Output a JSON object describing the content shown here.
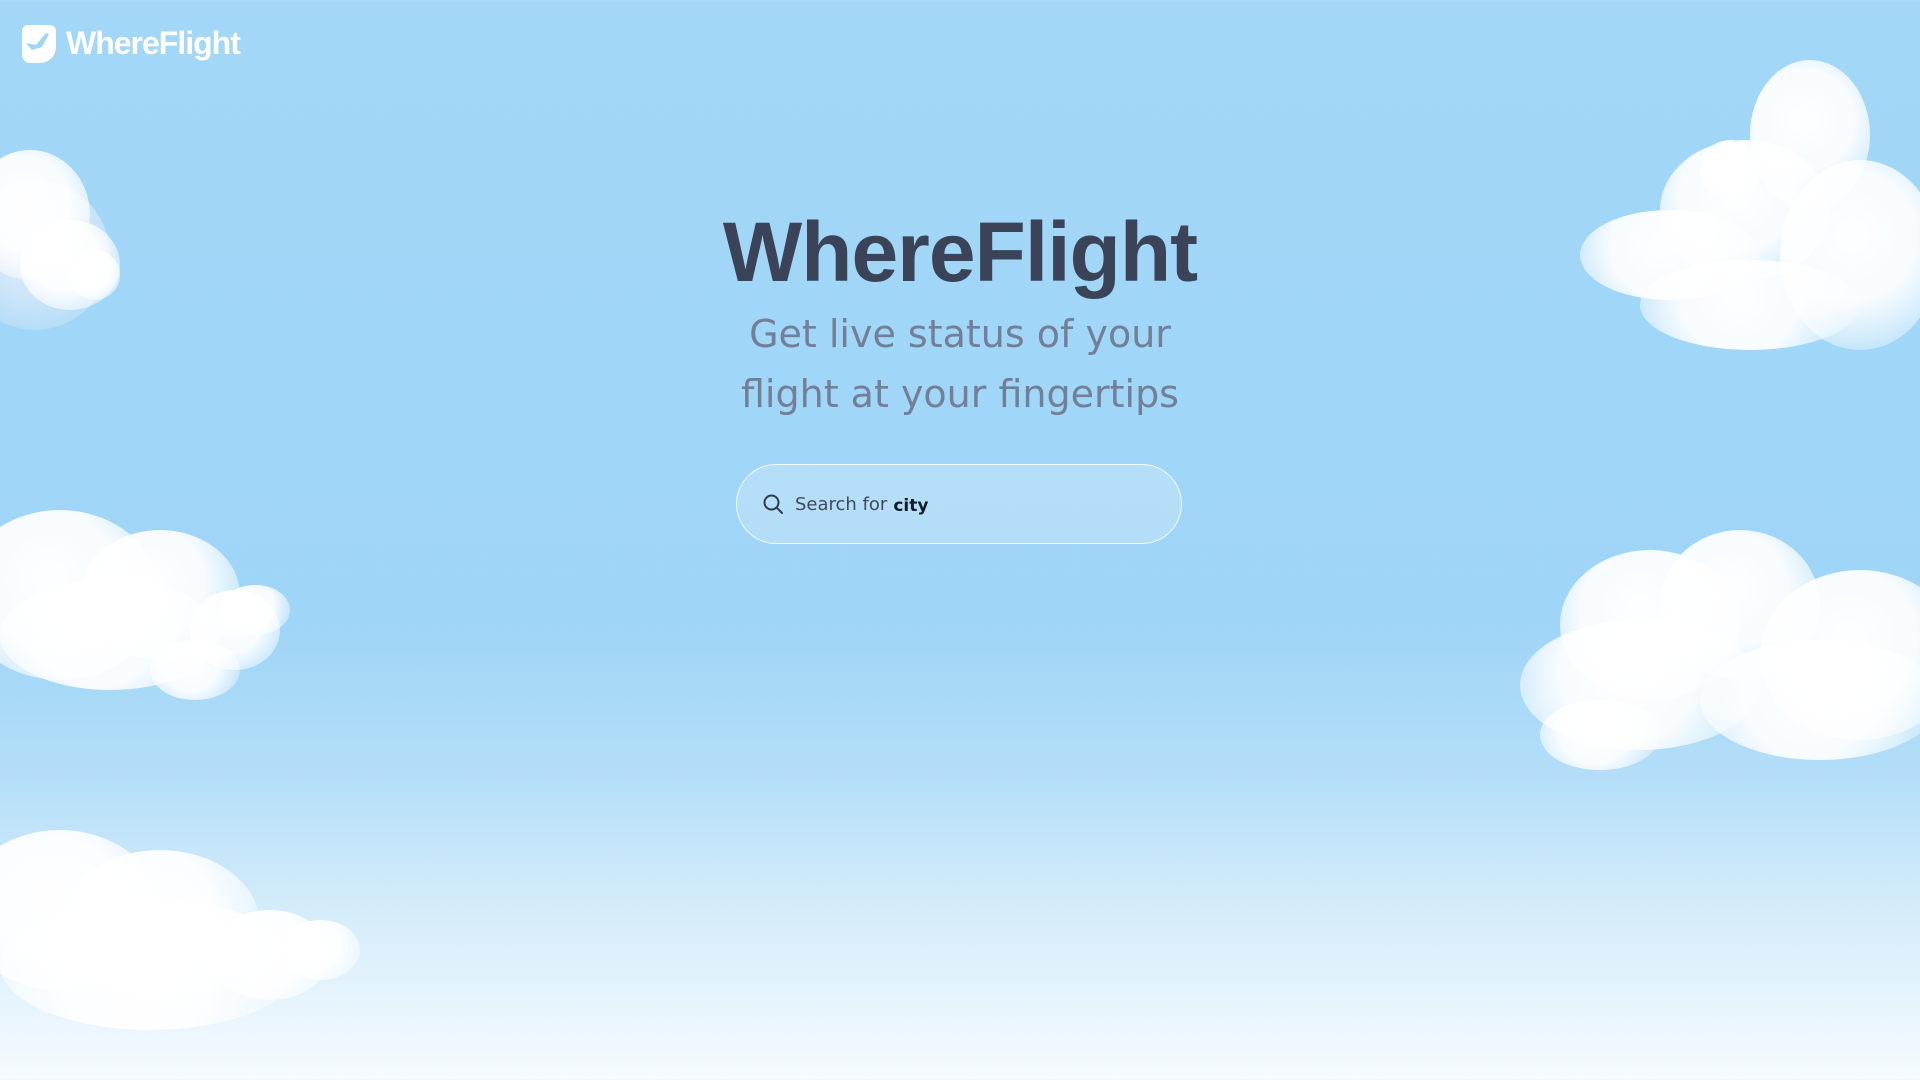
{
  "header": {
    "brand": "WhereFlight",
    "logo_icon": "plane-icon"
  },
  "hero": {
    "title": "WhereFlight",
    "subtitle": "Get live status of your flight at your fingertips"
  },
  "search": {
    "prefix": "Search for",
    "value": "city",
    "icon": "search-icon"
  },
  "colors": {
    "sky_top": "#a2d7f7",
    "sky_bottom": "#f6fbfe",
    "title": "#3a4357",
    "subtitle": "#727f96"
  }
}
